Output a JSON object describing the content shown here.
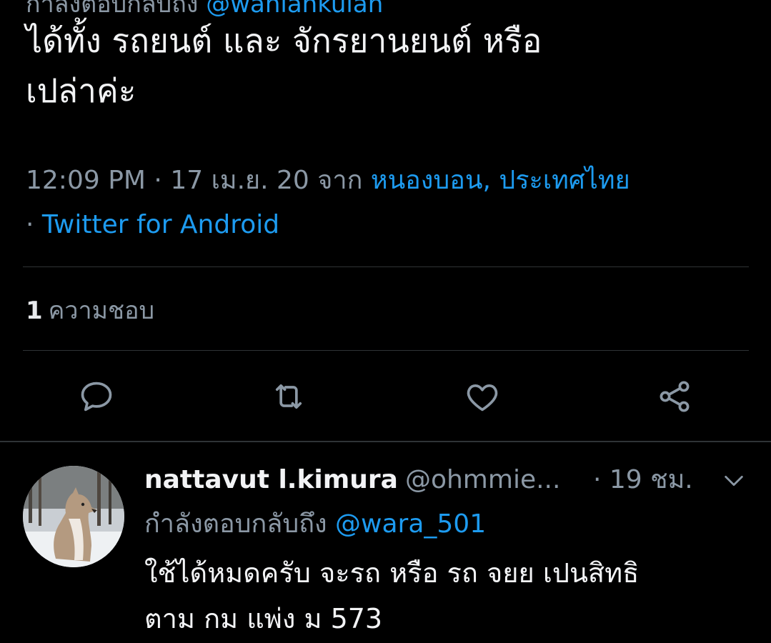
{
  "tweet": {
    "replying_to_cut_prefix": "กำลังตอบกลับถึง ",
    "replying_to_cut_handle": "@wanlankulan",
    "body_line1": "ได้ทั้ง รถยนต์ และ จักรยานยนต์ หรือ",
    "body_line2": "เปล่าค่ะ",
    "time": "12:09 PM",
    "dot1": " · ",
    "date": "17 เม.ย. 20",
    "from_label": " จาก ",
    "location": "หนองบอน, ประเทศไทย",
    "dot2": "· ",
    "source": "Twitter for Android",
    "like_count": "1",
    "like_label": "ความชอบ"
  },
  "actions": [
    {
      "name": "reply",
      "icon": "comment-icon"
    },
    {
      "name": "retweet",
      "icon": "retweet-icon"
    },
    {
      "name": "like",
      "icon": "heart-icon"
    },
    {
      "name": "share",
      "icon": "share-icon"
    }
  ],
  "reply": {
    "display_name": "nattavut l.kimura",
    "handle": "@ohmmie...",
    "time": "· 19 ชม.",
    "replying_prefix": "กำลังตอบกลับถึง ",
    "replying_handle": "@wara_501",
    "text_line1": "ใช้ได้หมดครับ จะรถ หรือ รถ จยย เปนสิทธิ",
    "text_line2": "ตาม กม แพ่ง ม 573",
    "avatar_icon": "avatar-dog-photo",
    "menu_icon": "chevron-down-icon"
  },
  "colors": {
    "background": "#000000",
    "text": "#f2f3f5",
    "muted": "#8b98a5",
    "link": "#1d9bf0",
    "divider": "#2f3336"
  }
}
